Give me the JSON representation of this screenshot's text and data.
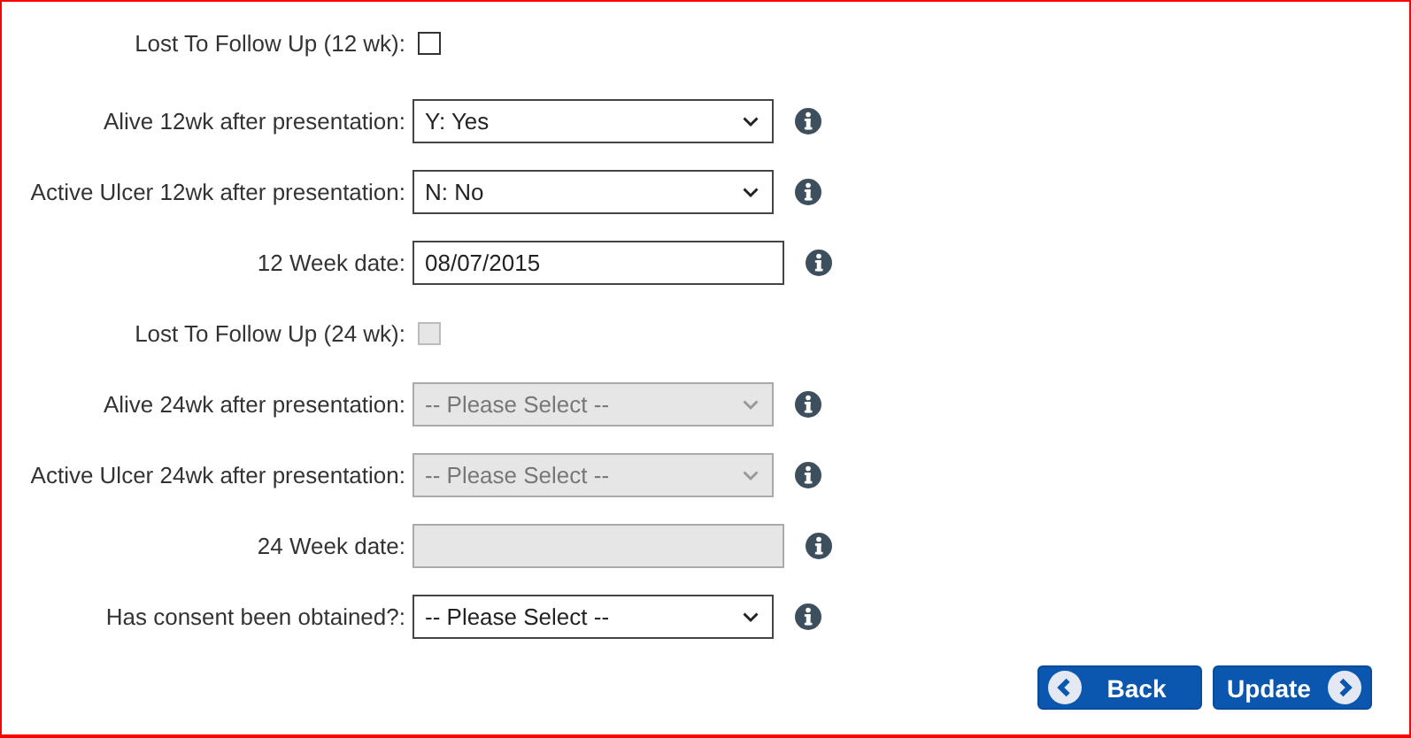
{
  "fields": [
    {
      "kind": "checkbox",
      "label": "Lost To Follow Up (12 wk):",
      "checked": false,
      "disabled": false
    },
    {
      "kind": "select",
      "label": "Alive 12wk after presentation:",
      "value": "Y: Yes",
      "disabled": false
    },
    {
      "kind": "select",
      "label": "Active Ulcer 12wk after presentation:",
      "value": "N: No",
      "disabled": false
    },
    {
      "kind": "date",
      "label": "12 Week date:",
      "value": "08/07/2015",
      "disabled": false
    },
    {
      "kind": "checkbox",
      "label": "Lost To Follow Up (24 wk):",
      "checked": false,
      "disabled": true
    },
    {
      "kind": "select",
      "label": "Alive 24wk after presentation:",
      "value": "-- Please Select --",
      "disabled": true
    },
    {
      "kind": "select",
      "label": "Active Ulcer 24wk after presentation:",
      "value": "-- Please Select --",
      "disabled": true
    },
    {
      "kind": "date",
      "label": "24 Week date:",
      "disabled": true
    },
    {
      "kind": "select",
      "label": "Has consent been obtained?:",
      "value": "-- Please Select --",
      "disabled": false
    }
  ],
  "buttons": [
    {
      "label": "Back",
      "kind": "back"
    },
    {
      "label": "Update",
      "kind": "next"
    }
  ]
}
